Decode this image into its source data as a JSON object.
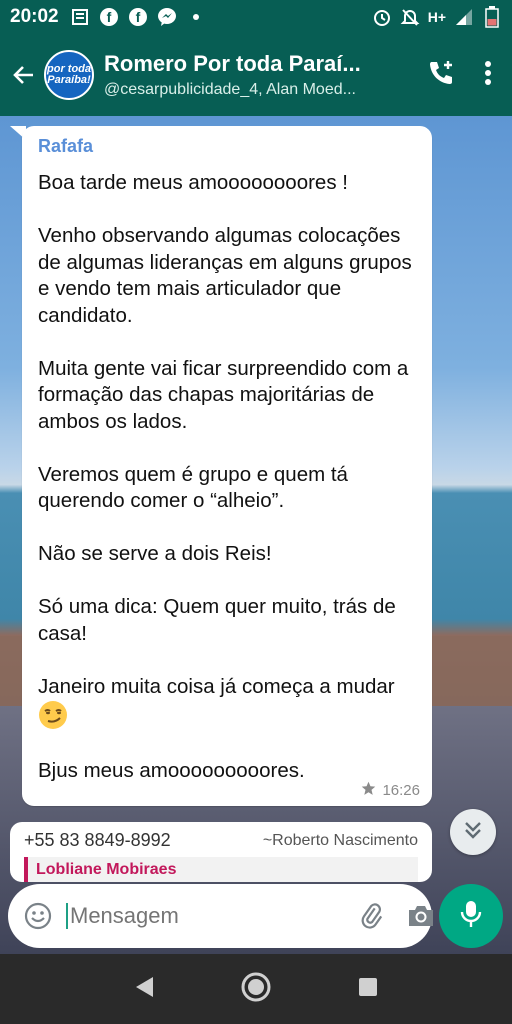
{
  "status_bar": {
    "time": "20:02",
    "network": "H+",
    "left_icons": [
      "notes-icon",
      "facebook-icon",
      "facebook-icon",
      "messenger-icon",
      "dot-icon"
    ],
    "right_icons": [
      "alarm-icon",
      "mute-icon",
      "signal-icon",
      "battery-icon"
    ]
  },
  "header": {
    "title": "Romero Por toda Paraí...",
    "subtitle": "@cesarpublicidade_4, Alan Moed...",
    "avatar_logo_line1": "por toda",
    "avatar_logo_line2": "Paraíba!"
  },
  "message": {
    "sender": "Rafafa",
    "paragraphs": [
      "Boa tarde meus amoooooooores !",
      "Venho observando algumas colocações de algumas lideranças em alguns grupos e vendo tem mais articulador que candidato.",
      "Muita gente vai ficar surpreendido com a formação das chapas majoritárias de ambos os lados.",
      "Veremos quem é grupo e quem tá querendo comer o “alheio”.",
      "Não se serve a dois Reis!",
      "Só uma dica: Quem quer muito, trás de casa!",
      "Janeiro muita coisa já começa a mudar",
      "Bjus meus amooooooooores."
    ],
    "time": "16:26",
    "starred": true
  },
  "next_message": {
    "phone": "+55 83 8849-8992",
    "author": "~Roberto Nascimento",
    "quote_preview": "Lobliane Mobiraes"
  },
  "composer": {
    "placeholder": "Mensagem"
  },
  "colors": {
    "header": "#075e54",
    "accent": "#00a884",
    "sender_name": "#5a8fd8"
  }
}
